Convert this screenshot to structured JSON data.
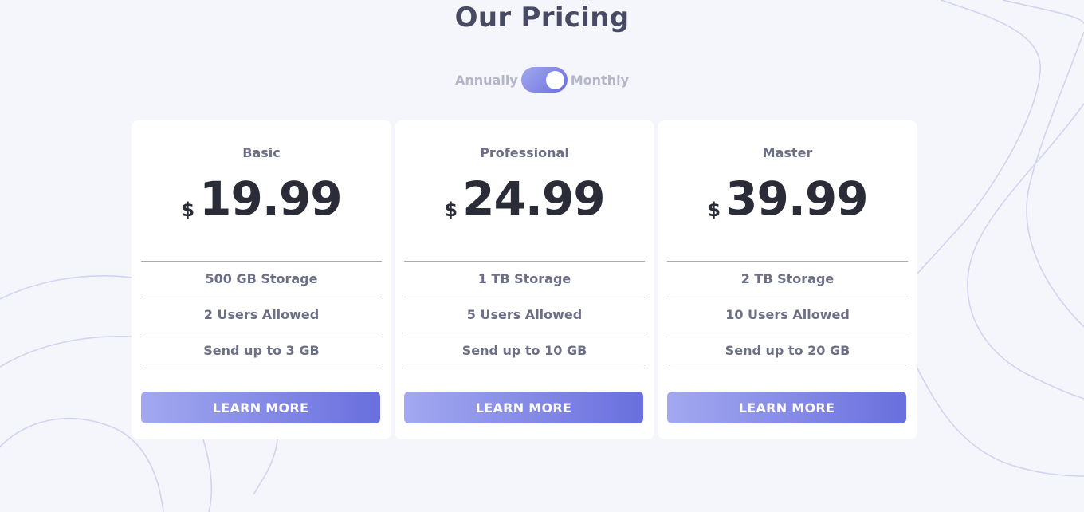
{
  "header": {
    "title": "Our Pricing"
  },
  "billing_toggle": {
    "left_label": "Annually",
    "right_label": "Monthly",
    "selected": "Monthly"
  },
  "currency_symbol": "$",
  "plans": [
    {
      "name": "Basic",
      "price": "19.99",
      "features": [
        "500 GB Storage",
        "2 Users Allowed",
        "Send up to 3 GB"
      ],
      "cta": "LEARN MORE"
    },
    {
      "name": "Professional",
      "price": "24.99",
      "features": [
        "1 TB Storage",
        "5 Users Allowed",
        "Send up to 10 GB"
      ],
      "cta": "LEARN MORE"
    },
    {
      "name": "Master",
      "price": "39.99",
      "features": [
        "2 TB Storage",
        "10 Users Allowed",
        "Send up to 20 GB"
      ],
      "cta": "LEARN MORE"
    }
  ],
  "colors": {
    "background": "#f5f5fc",
    "accent_start": "#a3a8f0",
    "accent_end": "#696fdd",
    "price_text": "#2a2c38"
  }
}
